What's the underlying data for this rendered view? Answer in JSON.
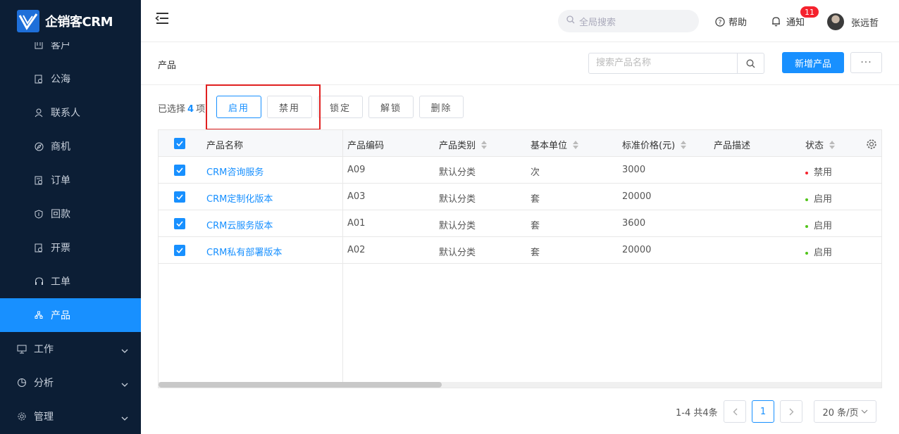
{
  "app": {
    "logo_text": "企销客CRM"
  },
  "sidebar": {
    "items": [
      {
        "label": "客户",
        "icon": "customer-icon"
      },
      {
        "label": "公海",
        "icon": "pool-icon"
      },
      {
        "label": "联系人",
        "icon": "contact-icon"
      },
      {
        "label": "商机",
        "icon": "compass-icon"
      },
      {
        "label": "订单",
        "icon": "order-icon"
      },
      {
        "label": "回款",
        "icon": "shield-icon"
      },
      {
        "label": "开票",
        "icon": "invoice-icon"
      },
      {
        "label": "工单",
        "icon": "headset-icon"
      },
      {
        "label": "产品",
        "icon": "product-icon",
        "active": true
      }
    ],
    "groups": [
      {
        "label": "工作",
        "icon": "monitor-icon"
      },
      {
        "label": "分析",
        "icon": "pie-chart-icon"
      },
      {
        "label": "管理",
        "icon": "gear-icon"
      }
    ]
  },
  "header": {
    "search_placeholder": "全局搜索",
    "help_label": "帮助",
    "notify_label": "通知",
    "notify_count": "11",
    "username": "张远哲"
  },
  "page": {
    "title": "产品",
    "search_placeholder": "搜索产品名称",
    "add_button": "新增产品",
    "more_button": "···"
  },
  "selection": {
    "prefix": "已选择",
    "count": "4",
    "suffix": "项"
  },
  "actions": {
    "enable": "启用",
    "disable": "禁用",
    "lock": "锁定",
    "unlock": "解锁",
    "delete": "删除"
  },
  "table": {
    "columns": [
      "产品名称",
      "产品编码",
      "产品类别",
      "基本单位",
      "标准价格(元)",
      "产品描述",
      "状态"
    ],
    "rows": [
      {
        "name": "CRM咨询服务",
        "code": "A09",
        "category": "默认分类",
        "unit": "次",
        "price": "3000",
        "desc": "",
        "status": "禁用"
      },
      {
        "name": "CRM定制化版本",
        "code": "A03",
        "category": "默认分类",
        "unit": "套",
        "price": "20000",
        "desc": "",
        "status": "启用"
      },
      {
        "name": "CRM云服务版本",
        "code": "A01",
        "category": "默认分类",
        "unit": "套",
        "price": "3600",
        "desc": "",
        "status": "启用"
      },
      {
        "name": "CRM私有部署版本",
        "code": "A02",
        "category": "默认分类",
        "unit": "套",
        "price": "20000",
        "desc": "",
        "status": "启用"
      }
    ]
  },
  "pagination": {
    "total": "1-4 共4条",
    "current_page": "1",
    "page_size": "20 条/页"
  },
  "colors": {
    "sidebar_bg": "#0c1e35",
    "accent": "#1890ff",
    "status_enabled": "#52c41a",
    "status_disabled": "#f5222d",
    "highlight": "#e02020"
  }
}
